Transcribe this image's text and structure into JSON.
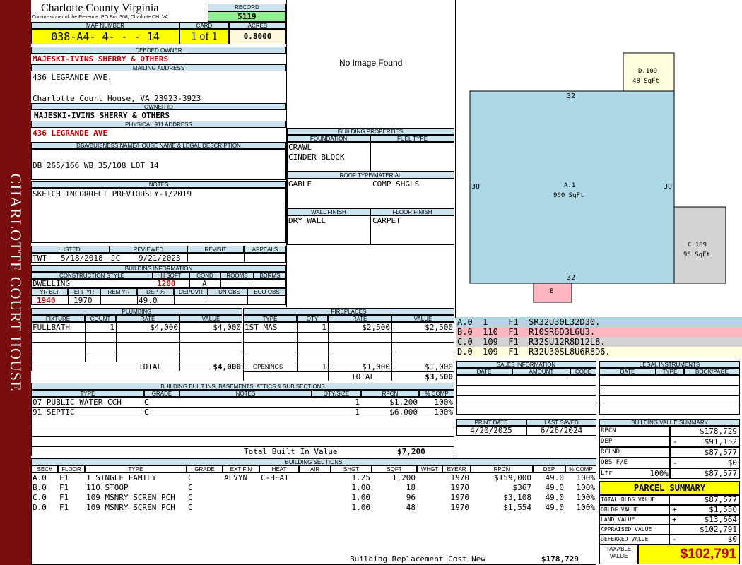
{
  "sidebar": {
    "text": "CHARLOTTE COURT HOUSE"
  },
  "county": {
    "name": "Charlotte County Virginia",
    "sub": "Commissioner of the Revenue, PO Box 308, Charlotte CH, VA"
  },
  "record": {
    "label": "RECORD",
    "value": "5119"
  },
  "map": {
    "label": "MAP NUMBER",
    "value": "038-A4- 4-  -  - 14"
  },
  "card": {
    "label": "CARD",
    "value": "1 of 1"
  },
  "acres": {
    "label": "ACRES",
    "value": "0.8000"
  },
  "deeded_owner": {
    "label": "DEEDED OWNER",
    "value": "MAJESKI-IVINS SHERRY & OTHERS"
  },
  "mailing": {
    "label": "MAILING ADDRESS",
    "line1": "436 LEGRANDE AVE.",
    "line2": "Charlotte Court House, VA 23923-3923"
  },
  "owner_id": {
    "label": "OWNER ID",
    "value": "MAJESKI-IVINS SHERRY & OTHERS"
  },
  "physical": {
    "label": "PHYSICAL 911 ADDRESS",
    "value": "436 LEGRANDE AVE"
  },
  "dba": {
    "label": "DBA/BUISNESS NAME/HOUSE NAME & LEGAL DESCRIPTION",
    "value": "DB 265/166 WB 35/108 LOT 14"
  },
  "notes": {
    "label": "NOTES",
    "value": "SKETCH INCORRECT PREVIOUSLY-1/2019"
  },
  "listed": {
    "label": "LISTED",
    "by": "TWT",
    "date": "5/18/2018"
  },
  "reviewed": {
    "label": "REVIEWED",
    "by": "JC",
    "date": "9/21/2023"
  },
  "revisit": {
    "label": "REVISIT"
  },
  "appeals": {
    "label": "APPEALS"
  },
  "building_info": {
    "label": "BUILDING INFORMATION",
    "h_construction": "CONSTRUCTION STYLE",
    "h_hsqft": "H SQFT",
    "h_cond": "COND",
    "h_rooms": "ROOMS",
    "h_bdrms": "BDRMS",
    "style": "DWELLING",
    "hsqft": "1200",
    "cond": "A",
    "h_yrblt": "YR BLT",
    "h_effyr": "EFF YR",
    "h_remyr": "REM YR",
    "h_dep": "DEP %",
    "h_depovr": "DEPOVR",
    "h_funobs": "FUN OBS",
    "h_ecoobs": "ECO OBS",
    "yrblt": "1940",
    "effyr": "1970",
    "dep": "49.0"
  },
  "image": {
    "text": "No Image Found"
  },
  "building_props": {
    "label": "BUILDING PROPERTIES",
    "h_foundation": "FOUNDATION",
    "h_fuel": "FUEL TYPE",
    "foundation1": "CRAWL",
    "foundation2": "CINDER BLOCK",
    "h_roof": "ROOF TYPE/MATERIAL",
    "roof1": "GABLE",
    "roof2": "COMP SHGLS",
    "h_wall": "WALL FINISH",
    "h_floor": "FLOOR FINISH",
    "wall": "DRY WALL",
    "floor": "CARPET"
  },
  "plumbing": {
    "label": "PLUMBING",
    "headers": [
      "FIXTURE",
      "COUNT",
      "RATE",
      "VALUE"
    ],
    "rows": [
      [
        "FULLBATH",
        "1",
        "$4,000",
        "$4,000"
      ]
    ],
    "total_label": "TOTAL",
    "total": "$4,000"
  },
  "fireplaces": {
    "label": "FIREPLACES",
    "headers": [
      "TYPE",
      "QTY",
      "RATE",
      "VALUE"
    ],
    "rows": [
      [
        "1ST MAS",
        "1",
        "$2,500",
        "$2,500"
      ]
    ],
    "openings_label": "OPENINGS",
    "openings_qty": "1",
    "openings_rate": "$1,000",
    "openings_value": "$1,000",
    "total_label": "TOTAL",
    "total": "$3,500"
  },
  "builtins": {
    "label": "BUILDING BUILT INS, BASEMENTS, ATTICS & SUB SECTIONS",
    "headers": [
      "TYPE",
      "GRADE",
      "NOTES",
      "QTY/SIZE",
      "RPCN",
      "% COMP"
    ],
    "rows": [
      [
        "07 PUBLIC WATER CCH",
        "C",
        "",
        "1",
        "$1,200",
        "100%"
      ],
      [
        "91 SEPTIC",
        "C",
        "",
        "1",
        "$6,000",
        "100%"
      ]
    ],
    "total_label": "Total Built In Value",
    "total": "$7,200"
  },
  "sections": {
    "label": "BUILDING SECTIONS",
    "headers": [
      "SEC#",
      "FLOOR",
      "TYPE",
      "GRADE",
      "EXT FIN",
      "HEAT",
      "AIR",
      "SHGT",
      "SQFT",
      "WHGT",
      "EYEAR",
      "RPCN",
      "DEP",
      "% COMP"
    ],
    "rows": [
      [
        "A.0",
        "F1",
        "1 SINGLE FAMILY",
        "C",
        "ALVYN",
        "C-HEAT",
        "",
        "1.25",
        "1,200",
        "",
        "1970",
        "$159,000",
        "49.0",
        "100%"
      ],
      [
        "B.0",
        "F1",
        "110 STOOP",
        "C",
        "",
        "",
        "",
        "1.00",
        "18",
        "",
        "1970",
        "$367",
        "49.0",
        "100%"
      ],
      [
        "C.0",
        "F1",
        "109 MSNRY SCREN PCH",
        "C",
        "",
        "",
        "",
        "1.00",
        "96",
        "",
        "1970",
        "$3,108",
        "49.0",
        "100%"
      ],
      [
        "D.0",
        "F1",
        "109 MSNRY SCREN PCH",
        "C",
        "",
        "",
        "",
        "1.00",
        "48",
        "",
        "1970",
        "$1,554",
        "49.0",
        "100%"
      ]
    ],
    "total_label": "Building Replacement Cost New",
    "total": "$178,729"
  },
  "sketch": {
    "a_label": "A.1",
    "a_area": "960 SqFt",
    "d_label": "D.109",
    "d_area": "48 SqFt",
    "c_label": "C.109",
    "c_area": "96 SqFt",
    "b_label": "B",
    "top": "32",
    "bottom": "32",
    "left": "30",
    "right": "30"
  },
  "sketch_codes": [
    {
      "text": "A.0  1    F1  SR32U30L32D30.",
      "color": "#add8e6"
    },
    {
      "text": "B.0  110  F1  R10SR6D3L6U3.",
      "color": "#ffb6c1"
    },
    {
      "text": "C.0  109  F1  R32SU12R8D12L8.",
      "color": "#d3d3d3"
    },
    {
      "text": "D.0  109  F1  R32U30SL8U6R8D6.",
      "color": "#ffffe0"
    }
  ],
  "sales": {
    "label": "SALES INFORMATION",
    "h_date": "DATE",
    "h_amount": "AMOUNT",
    "h_code": "CODE"
  },
  "legal": {
    "label": "LEGAL INSTRUMENTS",
    "h_date": "DATE",
    "h_type": "TYPE",
    "h_book": "BOOK/PAGE"
  },
  "print_date": {
    "label": "PRINT DATE",
    "value": "4/20/2025"
  },
  "last_saved": {
    "label": "LAST SAVED",
    "value": "6/26/2024"
  },
  "bvs": {
    "label": "BUILDING VALUE SUMMARY",
    "rows": [
      [
        "RPCN",
        "",
        "$178,729"
      ],
      [
        "DEP",
        "-",
        "$91,152"
      ],
      [
        "RCLND",
        "",
        "$87,577"
      ],
      [
        "OBS F/E",
        "-",
        "$0"
      ],
      [
        "Lfr",
        "100%",
        "$87,577"
      ]
    ]
  },
  "parcel": {
    "label": "PARCEL SUMMARY",
    "rows": [
      [
        "TOTAL BLDG VALUE",
        "",
        "$87,577"
      ],
      [
        "OBLDG VALUE",
        "+",
        "$1,550"
      ],
      [
        "LAND VALUE",
        "+",
        "$13,664"
      ],
      [
        "APPRAISED VALUE",
        "",
        "$102,791"
      ],
      [
        "DEFERRED VALUE",
        "-",
        "$0"
      ]
    ],
    "taxable_label1": "TAXABLE",
    "taxable_label2": "VALUE",
    "taxable": "$102,791"
  }
}
